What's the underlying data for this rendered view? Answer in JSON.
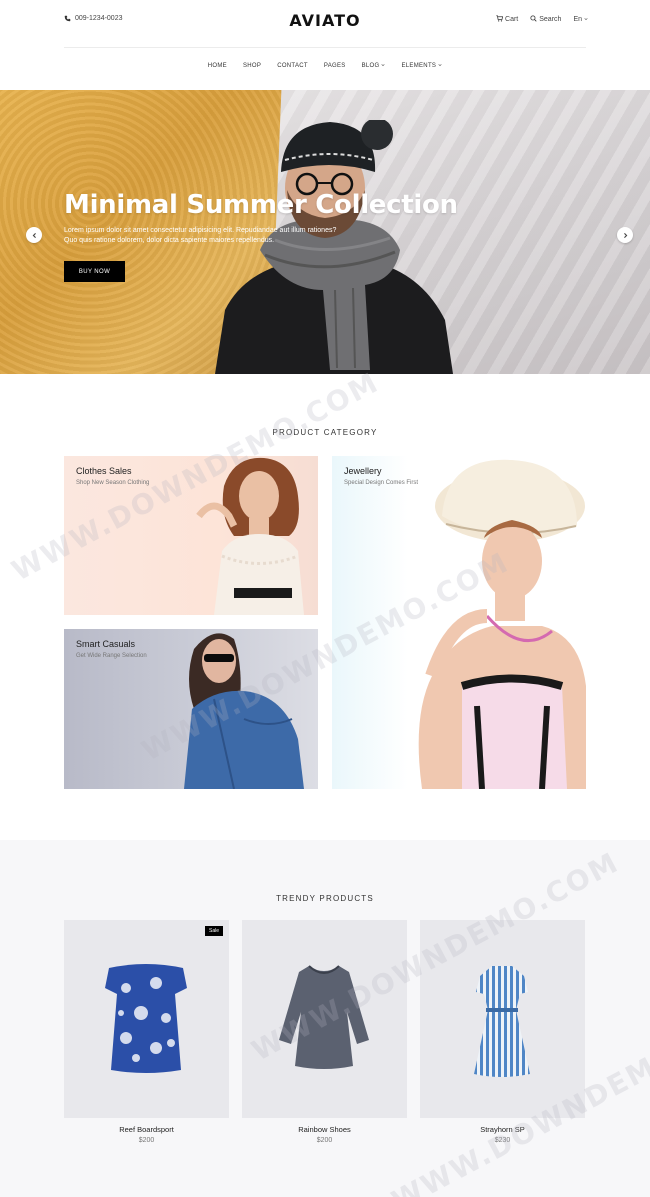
{
  "header": {
    "phone": "009-1234-0023",
    "logo": "AVIATO",
    "cart_label": "Cart",
    "search_label": "Search",
    "lang_label": "En"
  },
  "nav": {
    "items": [
      "HOME",
      "SHOP",
      "CONTACT",
      "PAGES",
      "BLOG",
      "ELEMENTS"
    ]
  },
  "hero": {
    "title": "Minimal Summer Collection",
    "subtitle_line1": "Lorem ipsum dolor sit amet consectetur adipisicing elit. Repudiandae aut illum rationes?",
    "subtitle_line2": "Quo quis ratione dolorem, dolor dicta sapiente maiores repellendus.",
    "button": "BUY NOW"
  },
  "categories": {
    "section_title": "PRODUCT CATEGORY",
    "items": [
      {
        "title": "Clothes Sales",
        "subtitle": "Shop New Season Clothing"
      },
      {
        "title": "Smart Casuals",
        "subtitle": "Get Wide Range Selection"
      },
      {
        "title": "Jewellery",
        "subtitle": "Special Design Comes First"
      }
    ]
  },
  "trendy": {
    "section_title": "TRENDY PRODUCTS",
    "products": [
      {
        "name": "Reef Boardsport",
        "price": "$200",
        "badge": "Sale"
      },
      {
        "name": "Rainbow Shoes",
        "price": "$200"
      },
      {
        "name": "Strayhorn SP",
        "price": "$230"
      }
    ]
  },
  "watermark": "WWW.DOWNDEMO.COM"
}
